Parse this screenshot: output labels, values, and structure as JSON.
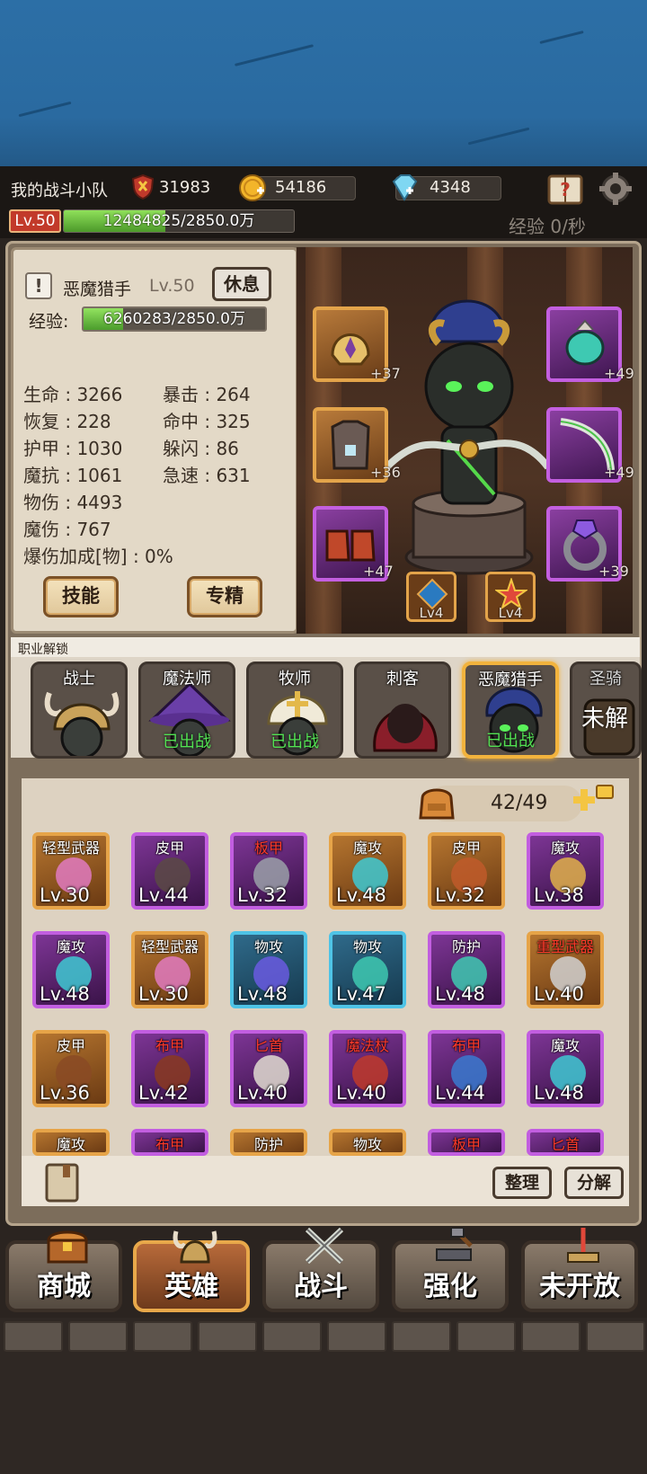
{
  "team": {
    "name": "我的战斗小队",
    "power": "31983"
  },
  "resources": {
    "gold": "54186",
    "diamonds": "4348"
  },
  "player": {
    "level": "Lv.50",
    "exp": "12484825/2850.0万",
    "exp_fraction": 0.44,
    "exp_rate": "经验 0/秒"
  },
  "hero": {
    "name": "恶魔猎手",
    "level": "Lv.50",
    "rest_label": "休息",
    "exp_label": "经验:",
    "exp": "6260283/2850.0万",
    "stats_left": [
      "生命 : 3266",
      "恢复 : 228",
      "护甲 : 1030",
      "魔抗 : 1061",
      "物伤 : 4493",
      "魔伤 : 767",
      "爆伤加成[物] : 0%"
    ],
    "stats_right": [
      "暴击 : 264",
      "命中 : 325",
      "躲闪 : 86",
      "急速 : 631"
    ],
    "skill_label": "技能",
    "mastery_label": "专精"
  },
  "equipment": {
    "helmet_plus": "+37",
    "armor_plus": "+36",
    "boots_plus": "+47",
    "amulet_plus": "+49",
    "weapon_plus": "+49",
    "ring_plus": "+39",
    "gem1_lv": "Lv4",
    "gem2_lv": "Lv4"
  },
  "classes": {
    "title": "职业解锁",
    "items": [
      {
        "name": "战士",
        "status": ""
      },
      {
        "name": "魔法师",
        "status": "已出战"
      },
      {
        "name": "牧师",
        "status": "已出战"
      },
      {
        "name": "刺客",
        "status": ""
      },
      {
        "name": "恶魔猎手",
        "status": "已出战"
      },
      {
        "name": "圣骑",
        "status": "未解"
      }
    ]
  },
  "inventory": {
    "count": "42/49",
    "sort_label": "整理",
    "decompose_label": "分解",
    "items": [
      {
        "type": "轻型武器",
        "lv": "Lv.30",
        "red": false
      },
      {
        "type": "皮甲",
        "lv": "Lv.44",
        "red": false
      },
      {
        "type": "板甲",
        "lv": "Lv.32",
        "red": true
      },
      {
        "type": "魔攻",
        "lv": "Lv.48",
        "red": false
      },
      {
        "type": "皮甲",
        "lv": "Lv.32",
        "red": false
      },
      {
        "type": "魔攻",
        "lv": "Lv.38",
        "red": false
      },
      {
        "type": "魔攻",
        "lv": "Lv.48",
        "red": false
      },
      {
        "type": "轻型武器",
        "lv": "Lv.30",
        "red": false
      },
      {
        "type": "物攻",
        "lv": "Lv.48",
        "red": false
      },
      {
        "type": "物攻",
        "lv": "Lv.47",
        "red": false
      },
      {
        "type": "防护",
        "lv": "Lv.48",
        "red": false
      },
      {
        "type": "重型武器",
        "lv": "Lv.40",
        "red": true
      },
      {
        "type": "皮甲",
        "lv": "Lv.36",
        "red": false
      },
      {
        "type": "布甲",
        "lv": "Lv.42",
        "red": true
      },
      {
        "type": "匕首",
        "lv": "Lv.40",
        "red": true
      },
      {
        "type": "魔法杖",
        "lv": "Lv.40",
        "red": true
      },
      {
        "type": "布甲",
        "lv": "Lv.44",
        "red": true
      },
      {
        "type": "魔攻",
        "lv": "Lv.48",
        "red": false
      },
      {
        "type": "魔攻",
        "lv": "",
        "red": false
      },
      {
        "type": "布甲",
        "lv": "",
        "red": true
      },
      {
        "type": "防护",
        "lv": "",
        "red": false
      },
      {
        "type": "物攻",
        "lv": "",
        "red": false
      },
      {
        "type": "板甲",
        "lv": "",
        "red": true
      },
      {
        "type": "匕首",
        "lv": "",
        "red": true
      }
    ]
  },
  "nav": {
    "shop": "商城",
    "hero": "英雄",
    "battle": "战斗",
    "upgrade": "强化",
    "locked": "未开放"
  }
}
